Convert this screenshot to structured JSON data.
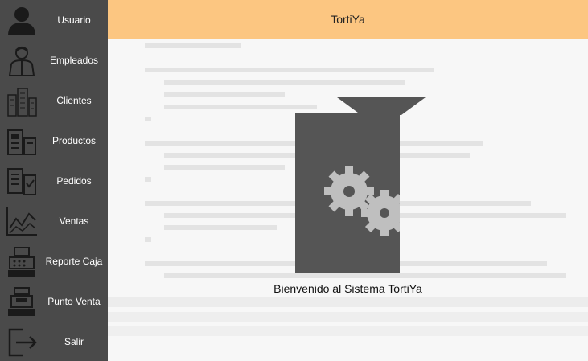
{
  "header": {
    "title": "TortiYa"
  },
  "welcome": {
    "text": "Bienvenido al Sistema TortiYa"
  },
  "sidebar": {
    "items": [
      {
        "label": "Usuario",
        "icon": "user-icon"
      },
      {
        "label": "Empleados",
        "icon": "employee-icon"
      },
      {
        "label": "Clientes",
        "icon": "clients-building-icon"
      },
      {
        "label": "Productos",
        "icon": "products-icon"
      },
      {
        "label": "Pedidos",
        "icon": "orders-icon"
      },
      {
        "label": "Ventas",
        "icon": "sales-chart-icon"
      },
      {
        "label": "Reporte Caja",
        "icon": "cash-register-icon"
      },
      {
        "label": "Punto Venta",
        "icon": "point-of-sale-icon"
      },
      {
        "label": "Salir",
        "icon": "exit-icon"
      }
    ]
  },
  "colors": {
    "sidebar_bg": "#4a4a4a",
    "header_bg": "#fcc681",
    "main_bg": "#f7f7f7",
    "logo_dark": "#555555",
    "logo_light": "#bfbfbf"
  }
}
